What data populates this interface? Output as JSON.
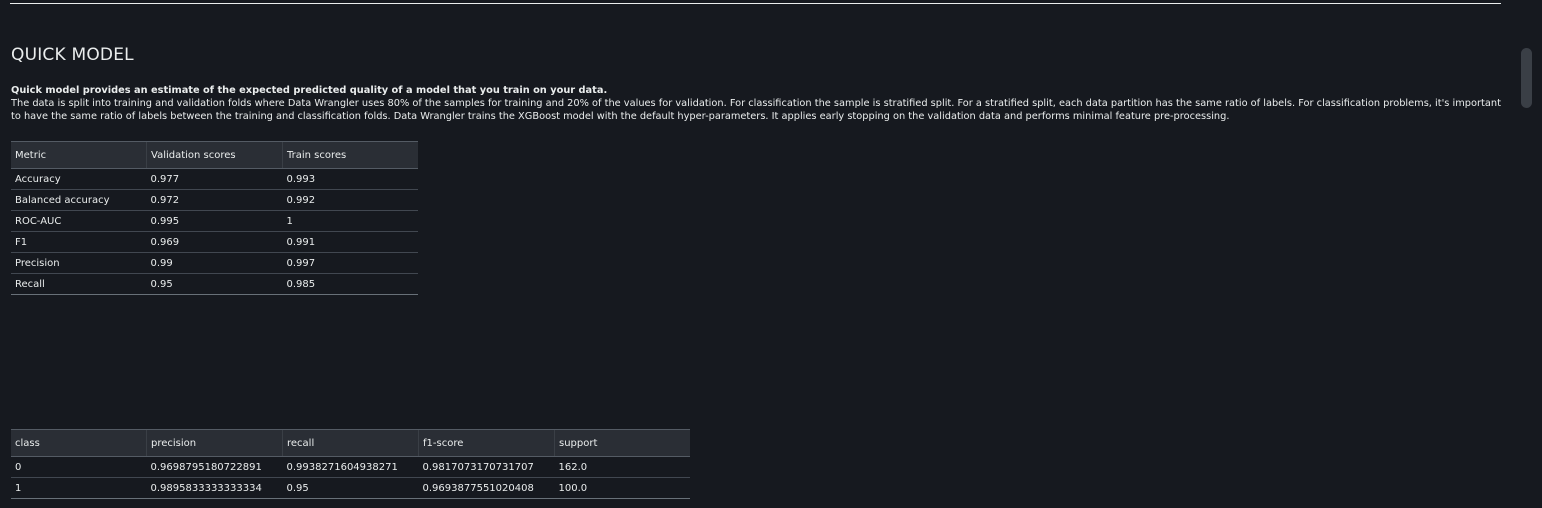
{
  "section": {
    "title": "QUICK MODEL",
    "lead": "Quick model provides an estimate of the expected predicted quality of a model that you train on your data.",
    "body": "The data is split into training and validation folds where Data Wrangler uses 80% of the samples for training and 20% of the values for validation. For classification the sample is stratified split. For a stratified split, each data partition has the same ratio of labels. For classification problems, it's important to have the same ratio of labels between the training and classification folds. Data Wrangler trains the XGBoost model with the default hyper-parameters. It applies early stopping on the validation data and performs minimal feature pre-processing."
  },
  "metrics_table": {
    "headers": [
      "Metric",
      "Validation scores",
      "Train scores"
    ],
    "rows": [
      [
        "Accuracy",
        "0.977",
        "0.993"
      ],
      [
        "Balanced accuracy",
        "0.972",
        "0.992"
      ],
      [
        "ROC-AUC",
        "0.995",
        "1"
      ],
      [
        "F1",
        "0.969",
        "0.991"
      ],
      [
        "Precision",
        "0.99",
        "0.997"
      ],
      [
        "Recall",
        "0.95",
        "0.985"
      ]
    ]
  },
  "class_table": {
    "headers": [
      "class",
      "precision",
      "recall",
      "f1-score",
      "support"
    ],
    "rows": [
      [
        "0",
        "0.9698795180722891",
        "0.9938271604938271",
        "0.9817073170731707",
        "162.0"
      ],
      [
        "1",
        "0.9895833333333334",
        "0.95",
        "0.9693877551020408",
        "100.0"
      ]
    ]
  },
  "colors": {
    "background": "#16191f",
    "header_background": "#2a2e35",
    "text": "#eaeded"
  }
}
